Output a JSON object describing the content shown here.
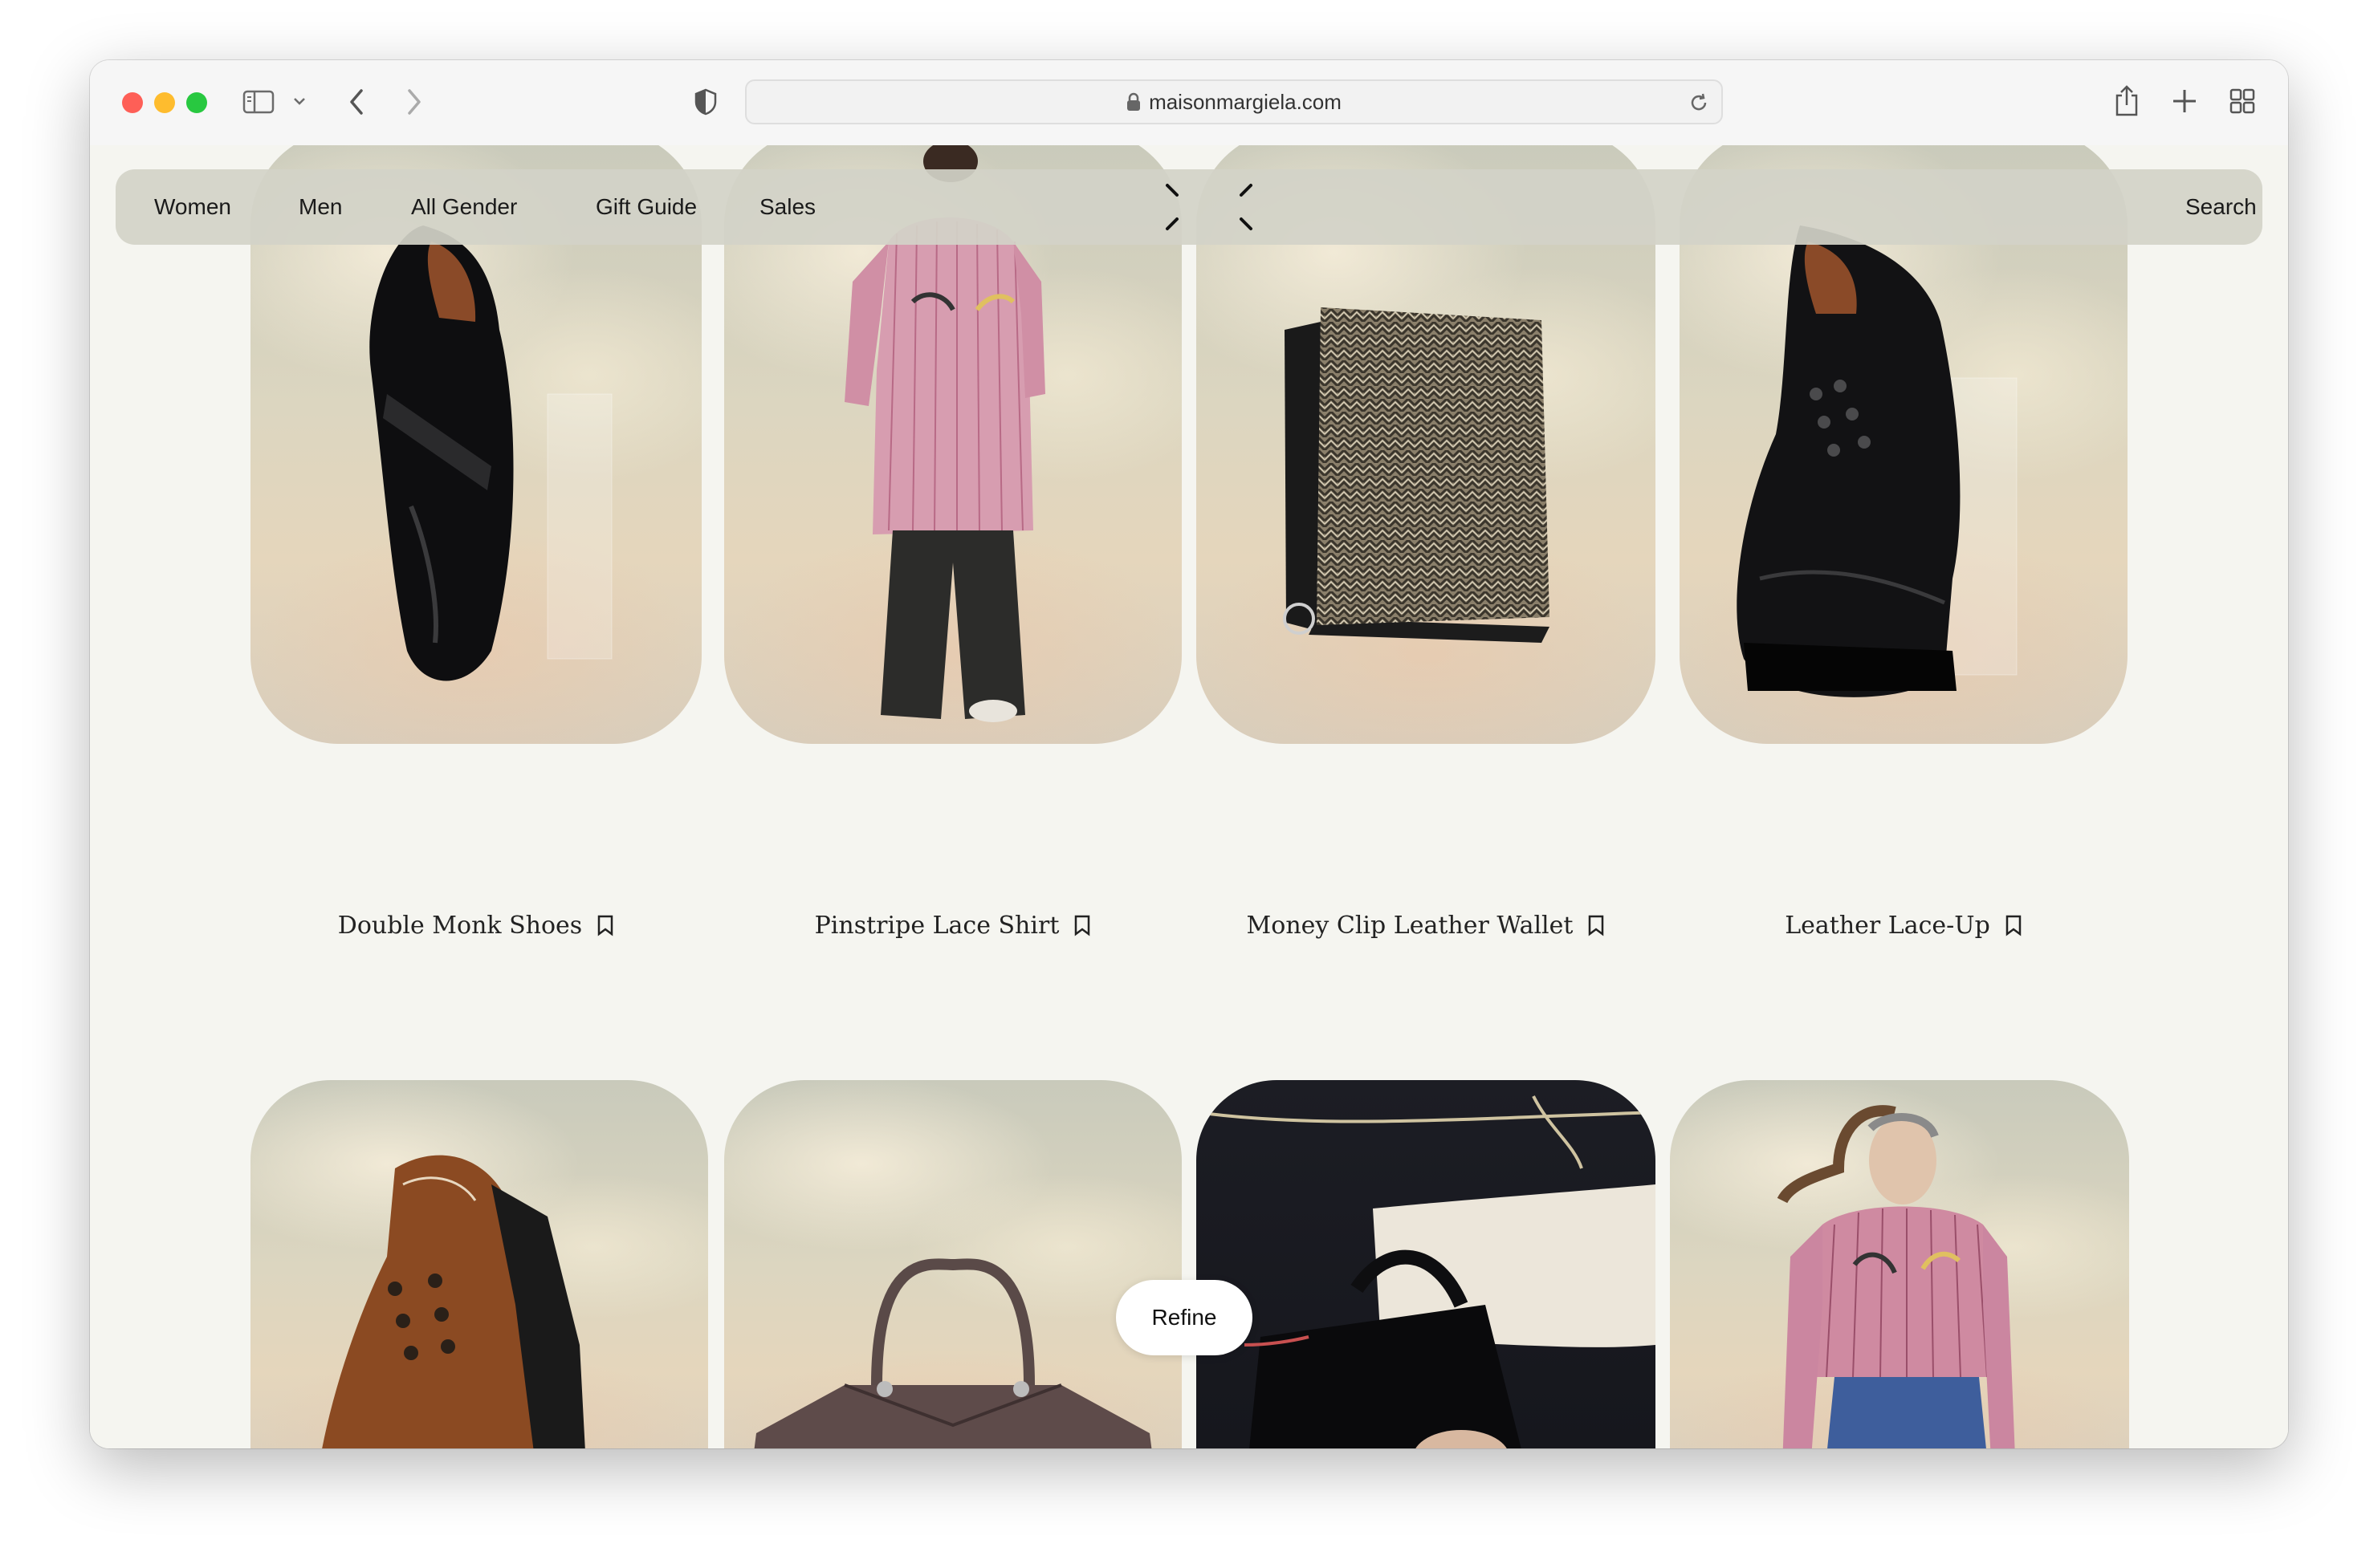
{
  "browser": {
    "url": "maisonmargiela.com",
    "icons": [
      "sidebar-icon",
      "chevron-down-icon",
      "back-icon",
      "forward-icon",
      "shield-icon",
      "lock-icon",
      "reload-icon",
      "share-icon",
      "new-tab-icon",
      "tab-overview-icon"
    ]
  },
  "nav": {
    "items": [
      "Women",
      "Men",
      "All Gender",
      "Gift Guide",
      "Sales"
    ],
    "search_label": "Search",
    "logo": "four-stitches-logo"
  },
  "products": [
    {
      "name": "Double Monk Shoes",
      "icon": "bookmark-icon"
    },
    {
      "name": "Pinstripe Lace Shirt",
      "icon": "bookmark-icon"
    },
    {
      "name": "Money Clip Leather Wallet",
      "icon": "bookmark-icon"
    },
    {
      "name": "Leather Lace-Up",
      "icon": "bookmark-icon"
    }
  ],
  "second_row": [
    "brown-lace-up-shoe",
    "taupe-handbag",
    "black-leather-bag",
    "model-pink-shirt"
  ],
  "refine_label": "Refine",
  "colors": {
    "page_bg": "#f5f5f0",
    "nav_bg": "#d2d2c8",
    "text": "#1a1a1a"
  }
}
